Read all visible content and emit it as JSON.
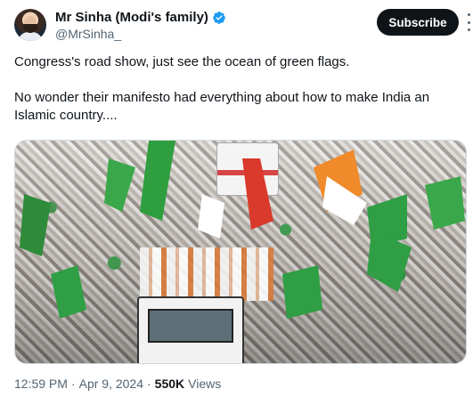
{
  "header": {
    "display_name": "Mr Sinha (Modi's family)",
    "handle": "@MrSinha_",
    "subscribe_label": "Subscribe",
    "verified_icon": "verified-badge-icon",
    "more_icon": "more-vertical-icon"
  },
  "tweet": {
    "paragraph_1": "Congress's road show, just see the ocean of green flags.",
    "paragraph_2": "No wonder their manifesto had everything about how to make India an Islamic country...."
  },
  "media": {
    "alt": "Crowd at road show with green flags"
  },
  "footer": {
    "time": "12:59 PM",
    "separator": "·",
    "date": "Apr 9, 2024",
    "views_count": "550K",
    "views_label": "Views"
  },
  "colors": {
    "text_primary": "#0f1419",
    "text_secondary": "#536471",
    "verified_blue": "#1d9bf0",
    "button_bg": "#0f1419"
  }
}
